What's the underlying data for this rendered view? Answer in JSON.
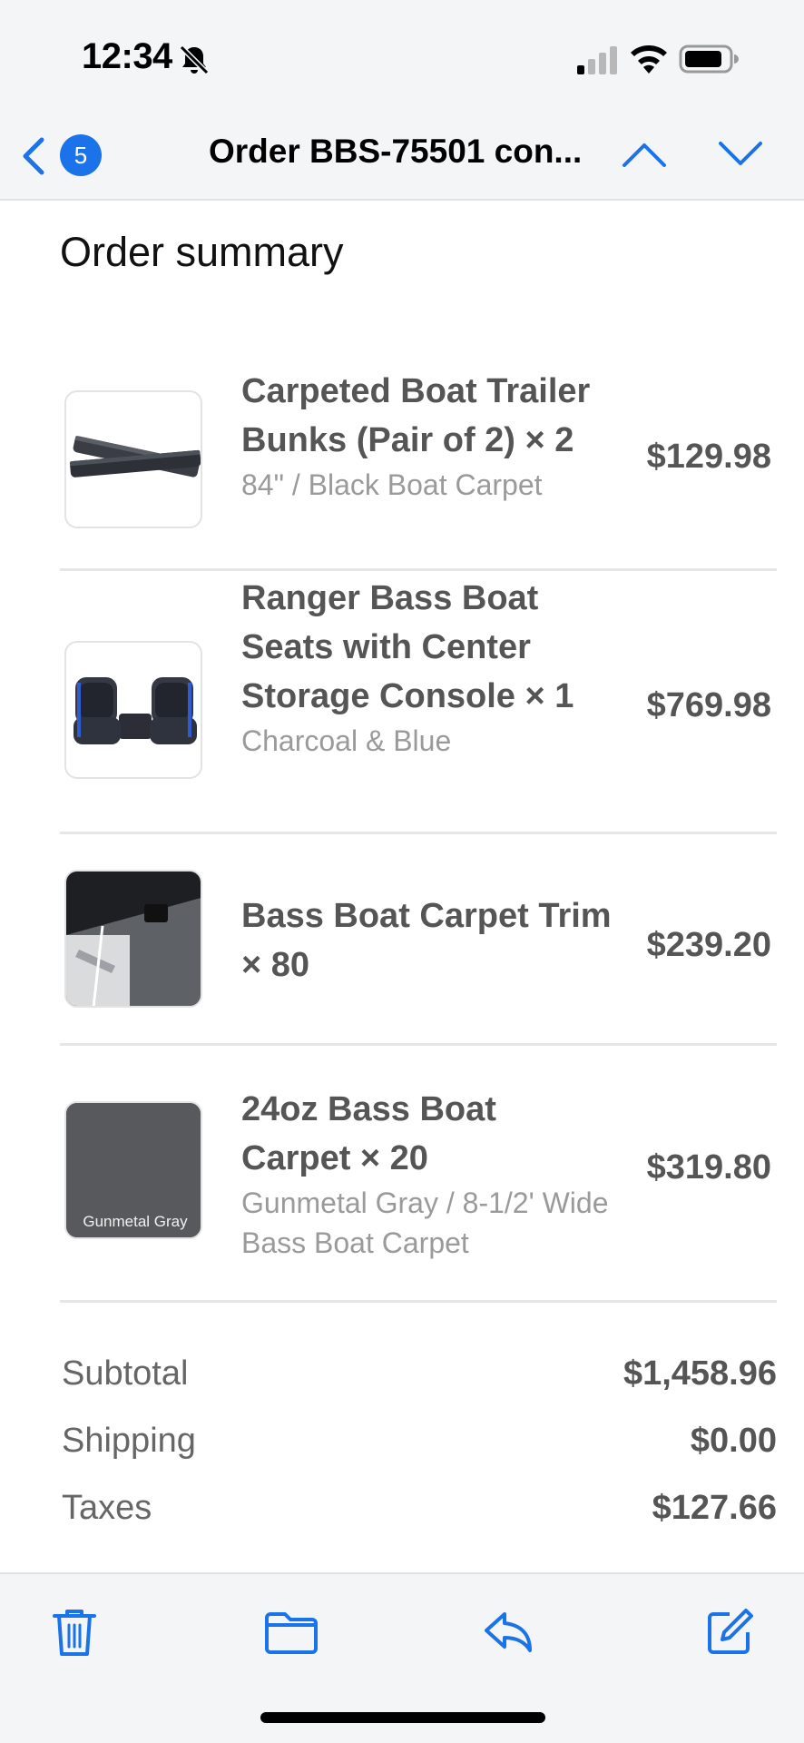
{
  "status_bar": {
    "time": "12:34",
    "icons": [
      "bell-slash-icon",
      "cellular-signal-icon",
      "wifi-icon",
      "battery-icon"
    ]
  },
  "nav": {
    "unread_count": "5",
    "title": "Order BBS-75501 con...",
    "icons": [
      "chevron-left-icon",
      "chevron-up-icon",
      "chevron-down-icon"
    ]
  },
  "summary": {
    "heading": "Order summary",
    "items": [
      {
        "name": "Carpeted Boat Trailer Bunks (Pair of 2) × 2",
        "variant": "84\" / Black Boat Carpet",
        "price": "$129.98"
      },
      {
        "name": "Ranger Bass Boat Seats with Center Storage Console × 1",
        "variant": "Charcoal & Blue",
        "price": "$769.98"
      },
      {
        "name": "Bass Boat Carpet Trim × 80",
        "variant": "",
        "price": "$239.20"
      },
      {
        "name": "24oz Bass Boat Carpet × 20",
        "variant": "Gunmetal Gray / 8-1/2' Wide Bass Boat Carpet",
        "price": "$319.80",
        "image_label": "Gunmetal Gray"
      }
    ]
  },
  "totals": [
    {
      "label": "Subtotal",
      "value": "$1,458.96"
    },
    {
      "label": "Shipping",
      "value": "$0.00"
    },
    {
      "label": "Taxes",
      "value": "$127.66"
    }
  ],
  "toolbar": {
    "icons": [
      "trash-icon",
      "folder-icon",
      "reply-icon",
      "compose-icon"
    ]
  },
  "colors": {
    "accent": "#1a73e8",
    "chrome_bg": "#f4f5f7",
    "price_text": "#555555",
    "variant_text": "#9a9a9a"
  }
}
